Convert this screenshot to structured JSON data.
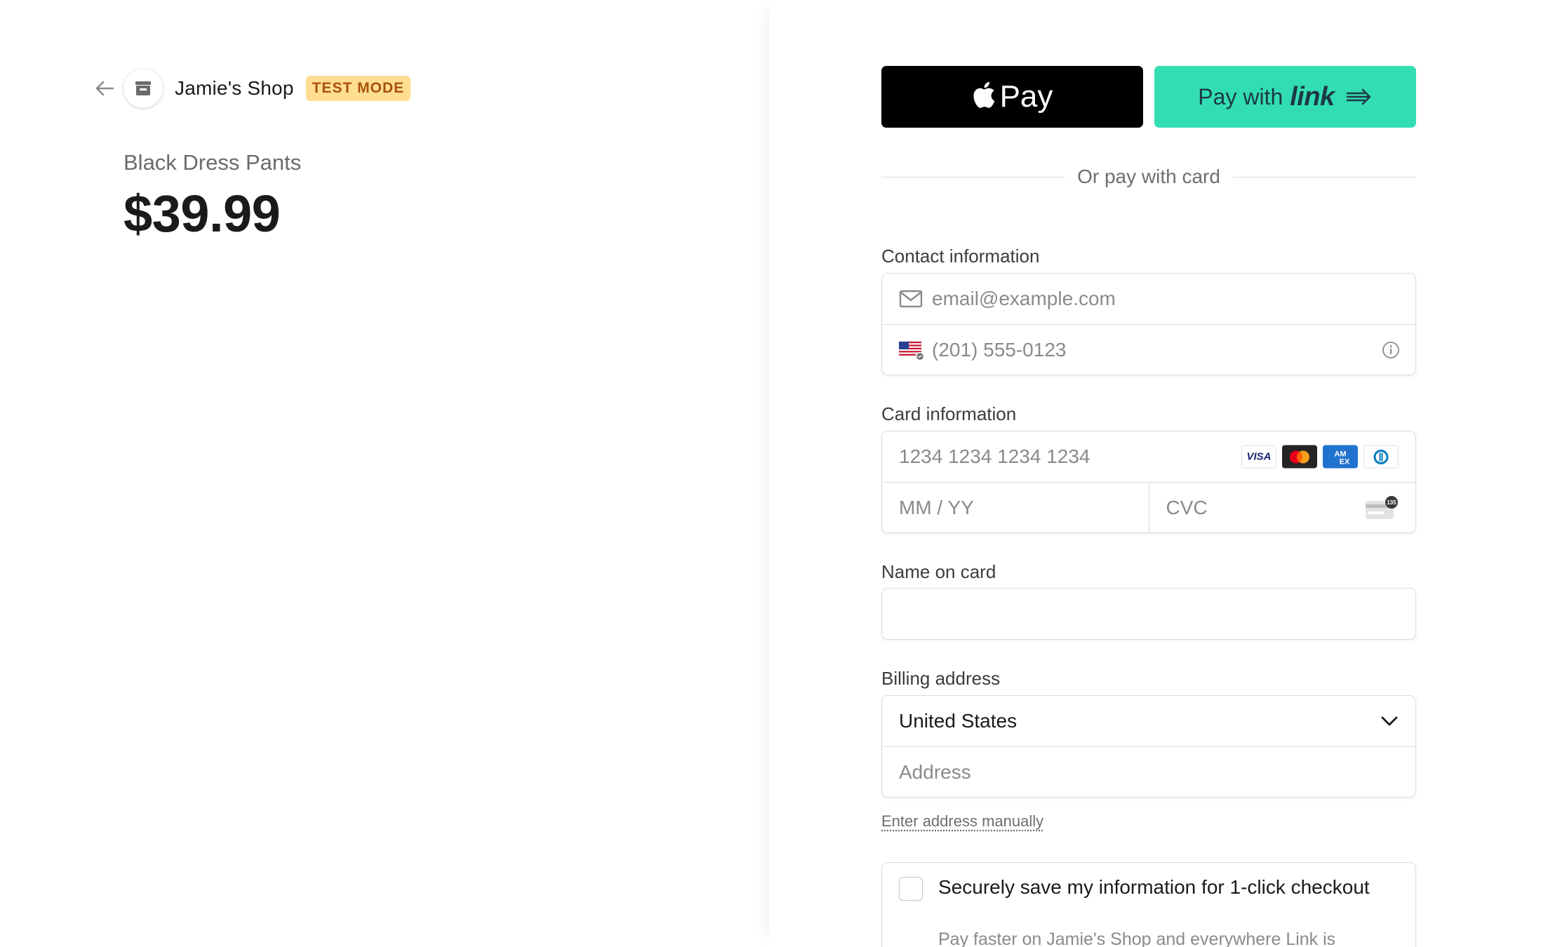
{
  "merchant": {
    "name": "Jamie's Shop",
    "badge": "TEST MODE",
    "back_icon": "arrow-left-icon",
    "avatar_icon": "store-icon"
  },
  "product": {
    "name": "Black Dress Pants",
    "price": "$39.99"
  },
  "payment_buttons": {
    "apple_pay_label": "Pay",
    "link_prefix": "Pay with",
    "link_word": "link"
  },
  "divider_text": "Or pay with card",
  "contact": {
    "label": "Contact information",
    "email_placeholder": "email@example.com",
    "phone_placeholder": "(201) 555-0123"
  },
  "card": {
    "label": "Card information",
    "number_placeholder": "1234 1234 1234 1234",
    "brands": [
      "VISA",
      "mastercard",
      "amex",
      "diners"
    ],
    "expiry_placeholder": "MM / YY",
    "cvc_placeholder": "CVC",
    "cvc_hint": "135"
  },
  "name_on_card": {
    "label": "Name on card",
    "value": ""
  },
  "billing": {
    "label": "Billing address",
    "country": "United States",
    "address_placeholder": "Address",
    "manual_link": "Enter address manually"
  },
  "save_info": {
    "title": "Securely save my information for 1-click checkout",
    "subtitle": "Pay faster on Jamie's Shop and everywhere Link is"
  },
  "colors": {
    "apple_pay_bg": "#000000",
    "link_bg": "#33ddb3",
    "badge_bg": "#ffde92",
    "badge_text": "#a9520a"
  }
}
